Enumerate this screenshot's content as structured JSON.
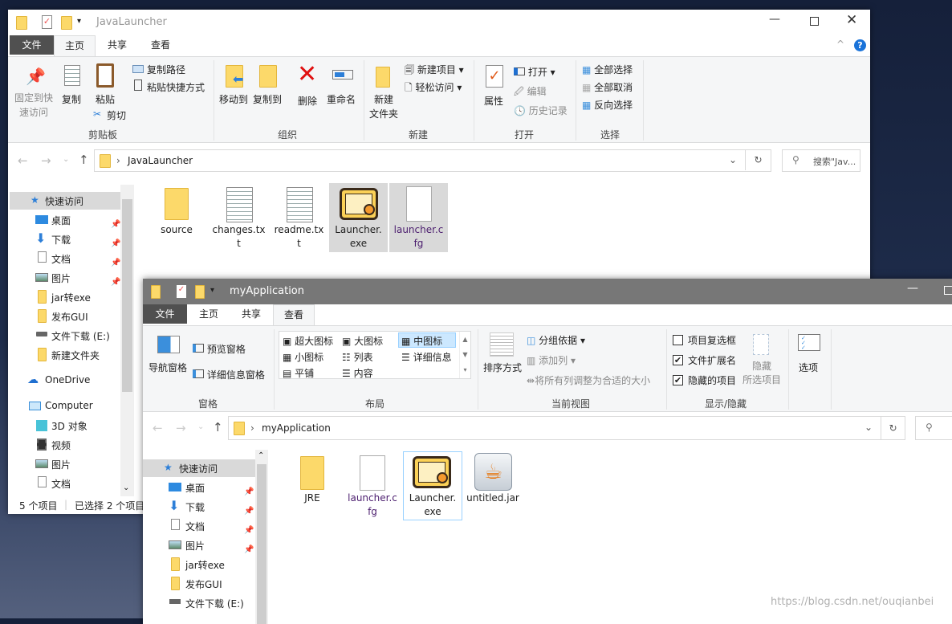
{
  "colors": {
    "accent": "#0078d7",
    "selected_bg": "#d9d9d9",
    "file_tab": "#505050",
    "inactive_title": "#777777"
  },
  "window1": {
    "title": "JavaLauncher",
    "tabs": [
      "文件",
      "主页",
      "共享",
      "查看"
    ],
    "active_tab": "主页",
    "ribbon": {
      "clipboard": {
        "label": "剪贴板",
        "pin_line1": "固定到快",
        "pin_line2": "速访问",
        "copy": "复制",
        "paste": "粘贴",
        "copy_path": "复制路径",
        "paste_shortcut": "粘贴快捷方式",
        "cut": "剪切"
      },
      "organize": {
        "label": "组织",
        "move_to": "移动到",
        "copy_to": "复制到",
        "delete": "删除",
        "rename": "重命名"
      },
      "new": {
        "label": "新建",
        "new_folder_line1": "新建",
        "new_folder_line2": "文件夹",
        "new_item": "新建项目",
        "easy_access": "轻松访问"
      },
      "open": {
        "label": "打开",
        "properties": "属性",
        "open": "打开",
        "edit": "编辑",
        "history": "历史记录"
      },
      "select": {
        "label": "选择",
        "select_all": "全部选择",
        "select_none": "全部取消",
        "invert": "反向选择"
      }
    },
    "address": {
      "path": "JavaLauncher",
      "search_placeholder": "搜索\"Jav..."
    },
    "sidebar": [
      {
        "label": "快速访问",
        "icon": "star-icon"
      },
      {
        "label": "桌面",
        "icon": "desktop-icon",
        "pinned": true
      },
      {
        "label": "下载",
        "icon": "download-icon",
        "pinned": true
      },
      {
        "label": "文档",
        "icon": "document-icon",
        "pinned": true
      },
      {
        "label": "图片",
        "icon": "picture-icon",
        "pinned": true
      },
      {
        "label": "jar转exe",
        "icon": "folder-icon"
      },
      {
        "label": "发布GUI",
        "icon": "folder-icon"
      },
      {
        "label": "文件下载 (E:)",
        "icon": "drive-icon"
      },
      {
        "label": "新建文件夹",
        "icon": "folder-icon"
      },
      {
        "label": "OneDrive",
        "icon": "cloud-icon"
      },
      {
        "label": "Computer",
        "icon": "computer-icon"
      },
      {
        "label": "3D 对象",
        "icon": "cube-icon"
      },
      {
        "label": "视频",
        "icon": "video-icon"
      },
      {
        "label": "图片",
        "icon": "picture-icon"
      },
      {
        "label": "文档",
        "icon": "document-icon"
      }
    ],
    "files": [
      {
        "l1": "source",
        "l2": "",
        "type": "folder"
      },
      {
        "l1": "changes.tx",
        "l2": "t",
        "type": "text"
      },
      {
        "l1": "readme.tx",
        "l2": "t",
        "type": "text"
      },
      {
        "l1": "Launcher.",
        "l2": "exe",
        "type": "exe",
        "selected": true
      },
      {
        "l1": "launcher.c",
        "l2": "fg",
        "type": "blank",
        "selected": true
      }
    ],
    "status": {
      "count": "5 个项目",
      "selected": "已选择 2 个项目"
    }
  },
  "window2": {
    "title": "myApplication",
    "tabs": [
      "文件",
      "主页",
      "共享",
      "查看"
    ],
    "active_tab": "查看",
    "ribbon": {
      "panes": {
        "label": "窗格",
        "nav_pane": "导航窗格",
        "preview_pane": "预览窗格",
        "details_pane": "详细信息窗格"
      },
      "layout": {
        "label": "布局",
        "options": [
          "超大图标",
          "大图标",
          "中图标",
          "小图标",
          "列表",
          "详细信息",
          "平铺",
          "内容"
        ],
        "selected": "中图标"
      },
      "current_view": {
        "label": "当前视图",
        "sort_by": "排序方式",
        "group_by": "分组依据",
        "add_columns": "添加列",
        "size_columns": "将所有列调整为合适的大小"
      },
      "show_hide": {
        "label": "显示/隐藏",
        "item_checkboxes": "项目复选框",
        "item_checkboxes_checked": false,
        "file_extensions": "文件扩展名",
        "file_extensions_checked": true,
        "hidden_items": "隐藏的项目",
        "hidden_items_checked": true,
        "hide_line1": "隐藏",
        "hide_line2": "所选项目"
      },
      "options": {
        "label": "选项"
      }
    },
    "address": {
      "path": "myApplication"
    },
    "sidebar": [
      {
        "label": "快速访问"
      },
      {
        "label": "桌面"
      },
      {
        "label": "下载"
      },
      {
        "label": "文档"
      },
      {
        "label": "图片"
      },
      {
        "label": "jar转exe"
      },
      {
        "label": "发布GUI"
      },
      {
        "label": "文件下载 (E:)"
      }
    ],
    "files": [
      {
        "l1": "JRE",
        "l2": "",
        "type": "folder"
      },
      {
        "l1": "launcher.c",
        "l2": "fg",
        "type": "blank"
      },
      {
        "l1": "Launcher.",
        "l2": "exe",
        "type": "exe",
        "focused": true
      },
      {
        "l1": "untitled.jar",
        "l2": "",
        "type": "jar"
      }
    ]
  },
  "watermark": "https://blog.csdn.net/ouqianbei"
}
